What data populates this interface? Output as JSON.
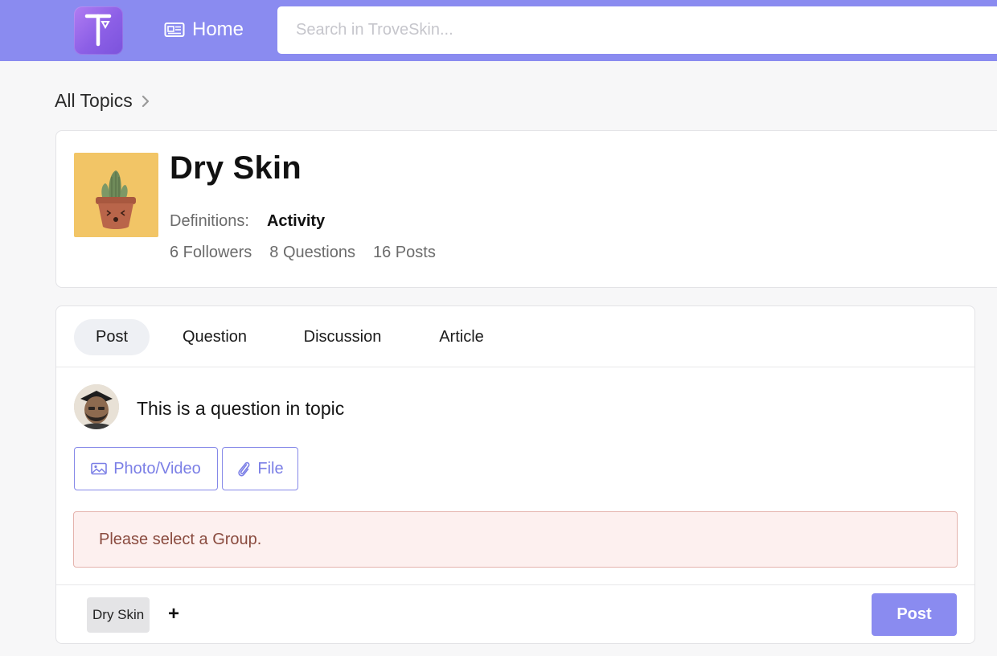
{
  "header": {
    "logo_alt": "TroveSkin logo",
    "home_label": "Home",
    "search_placeholder": "Search in TroveSkin..."
  },
  "breadcrumb": {
    "label": "All Topics"
  },
  "topic": {
    "title": "Dry Skin",
    "definitions_label": "Definitions:",
    "activity_label": "Activity",
    "followers": "6 Followers",
    "questions": "8 Questions",
    "posts": "16 Posts"
  },
  "composer": {
    "tabs": [
      {
        "label": "Post",
        "active": true
      },
      {
        "label": "Question",
        "active": false
      },
      {
        "label": "Discussion",
        "active": false
      },
      {
        "label": "Article",
        "active": false
      }
    ],
    "input_value": "This is a question in topic",
    "photo_video_label": "Photo/Video",
    "file_label": "File",
    "alert_text": "Please select a Group.",
    "tag_label": "Dry Skin",
    "add_tag_label": "+",
    "post_button_label": "Post"
  },
  "colors": {
    "brand": "#8a8bf0",
    "button_outline": "#8588e8",
    "alert_bg": "#fdf0ef",
    "alert_border": "#e4b3ad",
    "alert_text": "#8a4b3f"
  },
  "icons": {
    "logo": "troveskin-logo-icon",
    "home": "newspaper-icon",
    "breadcrumb": "chevron-right-icon",
    "photo": "image-icon",
    "file": "paperclip-icon"
  }
}
